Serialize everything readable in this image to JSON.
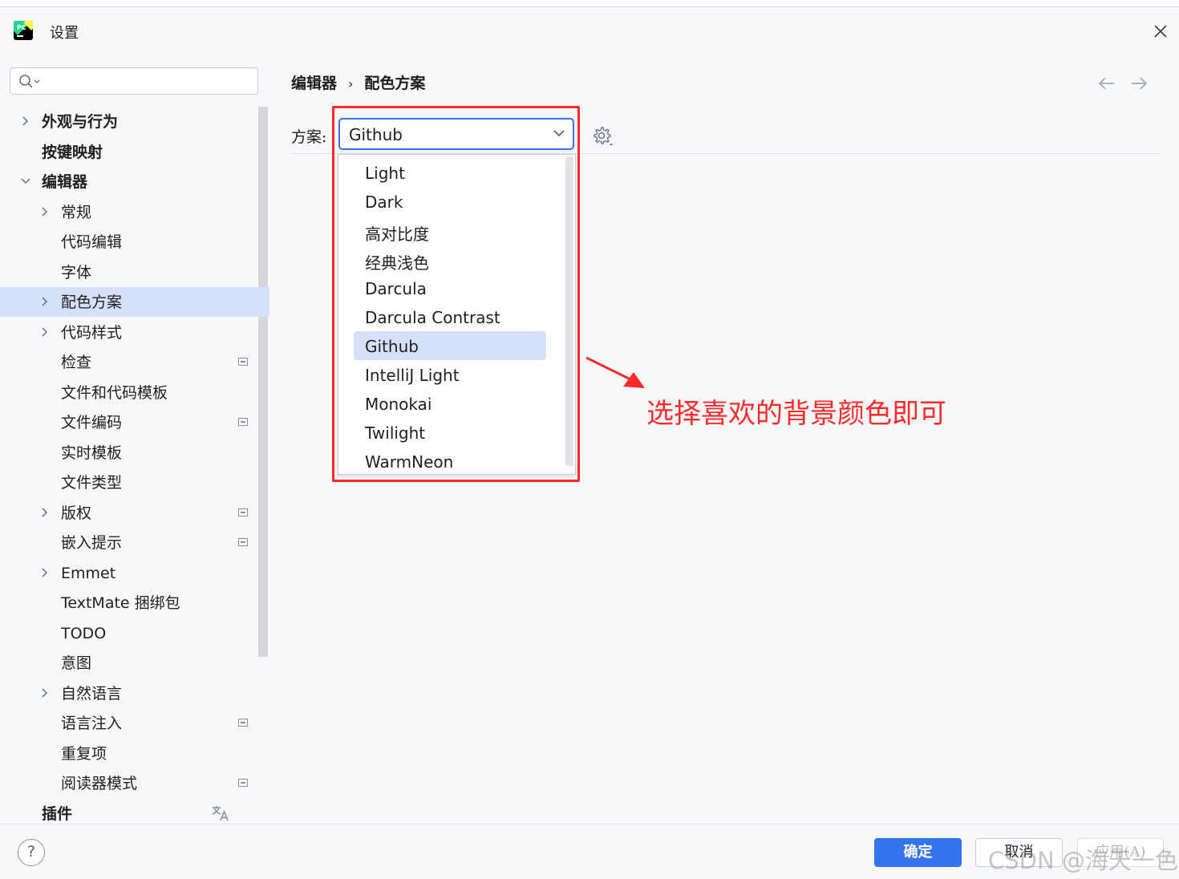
{
  "window": {
    "title": "设置",
    "close_icon": "close-icon"
  },
  "search": {
    "placeholder": ""
  },
  "sidebar": {
    "items": [
      {
        "label": "外观与行为",
        "level": 0,
        "expander": "collapsed",
        "bold": true
      },
      {
        "label": "按键映射",
        "level": 0,
        "expander": "none",
        "bold": true
      },
      {
        "label": "编辑器",
        "level": 0,
        "expander": "expanded",
        "bold": true
      },
      {
        "label": "常规",
        "level": 1,
        "expander": "collapsed"
      },
      {
        "label": "代码编辑",
        "level": 1,
        "expander": "none"
      },
      {
        "label": "字体",
        "level": 1,
        "expander": "none"
      },
      {
        "label": "配色方案",
        "level": 1,
        "expander": "collapsed",
        "selected": true
      },
      {
        "label": "代码样式",
        "level": 1,
        "expander": "collapsed"
      },
      {
        "label": "检查",
        "level": 1,
        "expander": "none",
        "project_badge": true
      },
      {
        "label": "文件和代码模板",
        "level": 1,
        "expander": "none"
      },
      {
        "label": "文件编码",
        "level": 1,
        "expander": "none",
        "project_badge": true
      },
      {
        "label": "实时模板",
        "level": 1,
        "expander": "none"
      },
      {
        "label": "文件类型",
        "level": 1,
        "expander": "none"
      },
      {
        "label": "版权",
        "level": 1,
        "expander": "collapsed",
        "project_badge": true
      },
      {
        "label": "嵌入提示",
        "level": 1,
        "expander": "none",
        "project_badge": true
      },
      {
        "label": "Emmet",
        "level": 1,
        "expander": "collapsed",
        "latin": true
      },
      {
        "label": "TextMate 捆绑包",
        "level": 1,
        "expander": "none",
        "latin": true
      },
      {
        "label": "TODO",
        "level": 1,
        "expander": "none",
        "latin": true
      },
      {
        "label": "意图",
        "level": 1,
        "expander": "none"
      },
      {
        "label": "自然语言",
        "level": 1,
        "expander": "collapsed"
      },
      {
        "label": "语言注入",
        "level": 1,
        "expander": "none",
        "project_badge": true
      },
      {
        "label": "重复项",
        "level": 1,
        "expander": "none"
      },
      {
        "label": "阅读器模式",
        "level": 1,
        "expander": "none",
        "project_badge": true
      },
      {
        "label": "插件",
        "level": 0,
        "expander": "none",
        "bold": true,
        "translate_icon": true
      }
    ]
  },
  "breadcrumb": {
    "parent": "编辑器",
    "separator": "›",
    "current": "配色方案"
  },
  "scheme": {
    "label": "方案:",
    "selected": "Github",
    "options": [
      "Light",
      "Dark",
      "高对比度",
      "经典浅色",
      "Darcula",
      "Darcula Contrast",
      "Github",
      "IntelliJ Light",
      "Monokai",
      "Twilight",
      "WarmNeon"
    ]
  },
  "annotation": {
    "text": "选择喜欢的背景颜色即可",
    "color": "#ff2a2a"
  },
  "footer": {
    "ok": "确定",
    "cancel": "取消",
    "apply": "应用(A)",
    "help": "?"
  },
  "watermark": "CSDN @海天一色y",
  "colors": {
    "accent": "#3574f0",
    "selection": "#d5e1fa",
    "annotation_red": "#ff2a2a"
  }
}
